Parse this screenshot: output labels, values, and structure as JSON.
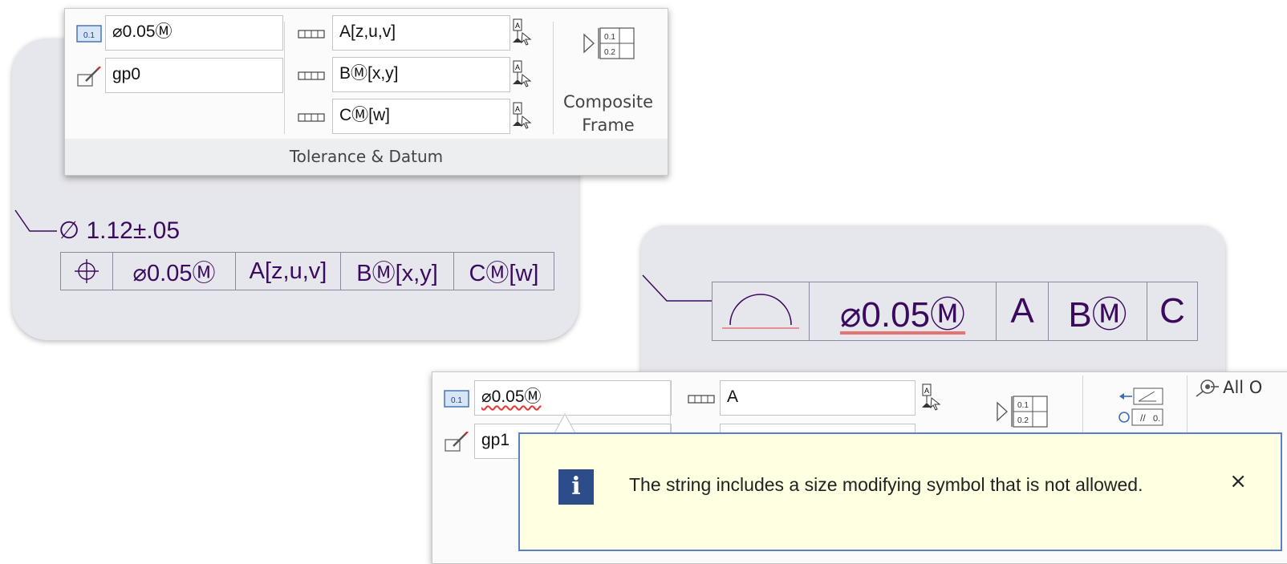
{
  "panel_top": {
    "tolerance_value": "⌀0.05Ⓜ",
    "geometry_name": "gp0",
    "datum_primary": "A[z,u,v]",
    "datum_secondary": "BⓂ[x,y]",
    "datum_tertiary": "CⓂ[w]",
    "composite_frame_line1": "Composite",
    "composite_frame_line2": "Frame",
    "group_label": "Tolerance & Datum"
  },
  "drawing_top": {
    "dimension_text": "∅ 1.12±.05",
    "fcf_cells": [
      "⌀0.05Ⓜ",
      "A[z,u,v]",
      "BⓂ[x,y]",
      "CⓂ[w]"
    ]
  },
  "drawing_bottom": {
    "fcf_cells": [
      "⌀0.05Ⓜ",
      "A",
      "BⓂ",
      "C"
    ]
  },
  "panel_bottom": {
    "tolerance_value": "⌀0.05Ⓜ",
    "geometry_name": "gp1",
    "datum_primary": "A",
    "all_label": "All O"
  },
  "message": {
    "text": "The string includes a size modifying symbol that is not allowed.",
    "close_label": "×"
  },
  "colors": {
    "annotation": "#3b0a5e",
    "balloon_bg": "#ffffe1",
    "info_icon": "#2d4c8a",
    "error_underline": "#e53935"
  }
}
